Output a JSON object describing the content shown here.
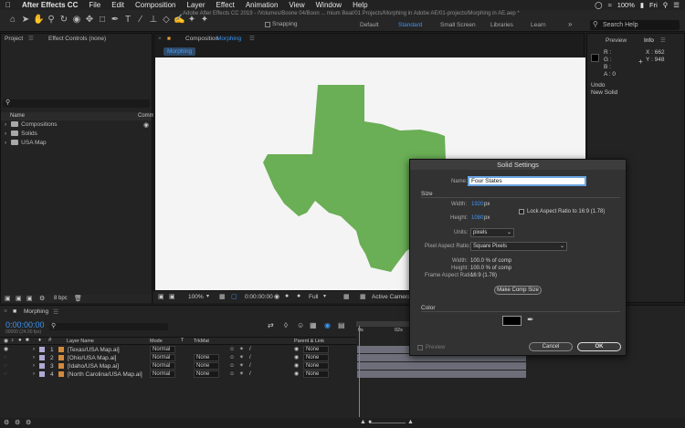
{
  "menubar": {
    "app": "After Effects CC",
    "items": [
      "File",
      "Edit",
      "Composition",
      "Layer",
      "Effect",
      "Animation",
      "View",
      "Window",
      "Help"
    ],
    "battery": "100%",
    "day": "Fri"
  },
  "window": {
    "title": "Adobe After Effects CC 2019 - /Volumes/Boone 04/Boon ... mium Beat/01 Projects/Morphing in Adobe AE/01-projects/Morphing in AE.aep *"
  },
  "toolbar": {
    "snapping": "Snapping"
  },
  "workspaces": {
    "items": [
      "Default",
      "Standard",
      "Small Screen",
      "Libraries",
      "Learn"
    ],
    "active": "Standard"
  },
  "search": {
    "placeholder": "Search Help"
  },
  "project": {
    "tab_project": "Project",
    "tab_effects": "Effect Controls (none)",
    "col_name": "Name",
    "col_comment": "Comm",
    "items": [
      "Compositions",
      "Solids",
      "USA Map"
    ],
    "bpc": "8 bpc"
  },
  "composition": {
    "tab_label": "Composition",
    "tab_name": "Morphing",
    "breadcrumb": "Morphing",
    "zoom": "100%",
    "timecode": "0:00:00:00",
    "resolution": "Full",
    "camera": "Active Camera"
  },
  "info": {
    "tab_preview": "Preview",
    "tab_info": "Info",
    "r": "R :",
    "g": "G :",
    "b": "B :",
    "a": "A : 0",
    "x": "X : 662",
    "y": "Y : 948",
    "undo": "Undo",
    "undo_action": "New Solid"
  },
  "timeline": {
    "tab": "Morphing",
    "timecode": "0:00:00:00",
    "frames": "00000 (24.00 fps)",
    "col_layer": "Layer Name",
    "col_mode": "Mode",
    "col_trkmat": "TrkMat",
    "col_parent": "Parent & Link",
    "ruler": [
      "0s",
      "02s"
    ],
    "layers": [
      {
        "num": "1",
        "name": "[Texas/USA Map.ai]",
        "mode": "Normal",
        "trkmat": "",
        "parent": "None"
      },
      {
        "num": "2",
        "name": "[Ohio/USA Map.ai]",
        "mode": "Normal",
        "trkmat": "None",
        "parent": "None"
      },
      {
        "num": "3",
        "name": "[Idaho/USA Map.ai]",
        "mode": "Normal",
        "trkmat": "None",
        "parent": "None"
      },
      {
        "num": "4",
        "name": "[North Carolina/USA Map.ai]",
        "mode": "Normal",
        "trkmat": "None",
        "parent": "None"
      }
    ]
  },
  "dialog": {
    "title": "Solid Settings",
    "name_label": "Name:",
    "name_value": "Four States",
    "size_section": "Size",
    "width_label": "Width:",
    "width_value": "1920",
    "width_unit": "px",
    "height_label": "Height:",
    "height_value": "1080",
    "height_unit": "px",
    "lock_label": "Lock Aspect Ratio to 16:9 (1.78)",
    "units_label": "Units:",
    "units_value": "pixels",
    "par_label": "Pixel Aspect Ratio:",
    "par_value": "Square Pixels",
    "pct_width_label": "Width:",
    "pct_width_value": "100.0 % of comp",
    "pct_height_label": "Height:",
    "pct_height_value": "100.0 % of comp",
    "far_label": "Frame Aspect Ratio:",
    "far_value": "16:9 (1.78)",
    "make_comp_size": "Make Comp Size",
    "color_section": "Color",
    "preview_label": "Preview",
    "cancel": "Cancel",
    "ok": "OK",
    "swatch_color": "#000000"
  },
  "colors": {
    "accent": "#3d95f0",
    "texas": "#6aae55"
  }
}
